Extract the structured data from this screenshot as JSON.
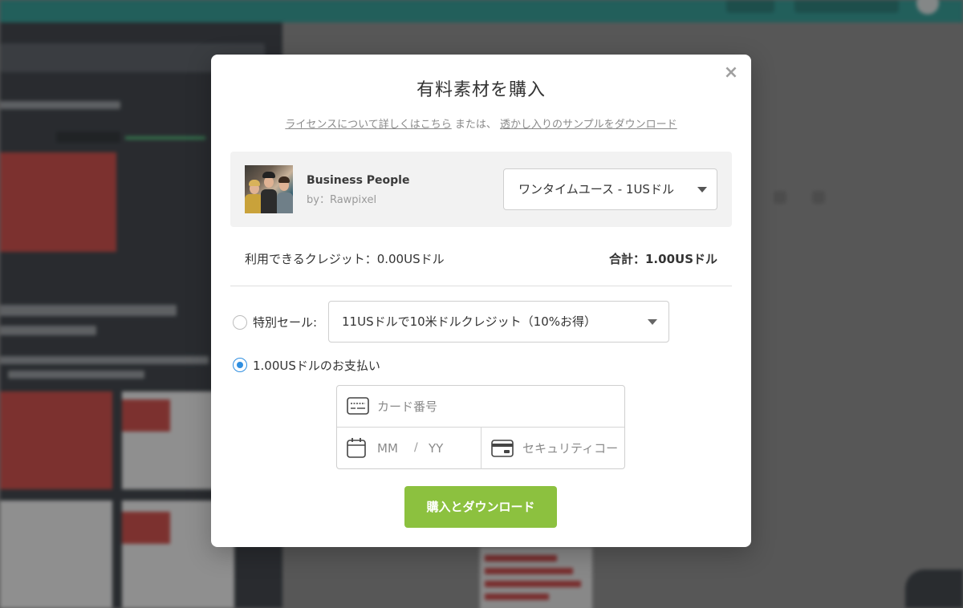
{
  "modal": {
    "title": "有料素材を購入",
    "close_symbol": "×",
    "license_link": "ライセンスについて詳しくはこちら",
    "separator_text": "または、",
    "sample_link": "透かし入りのサンプルをダウンロード",
    "item": {
      "name": "Business People",
      "author": "by：Rawpixel"
    },
    "license_option": "ワンタイムユース - 1USドル",
    "credits": "利用できるクレジット：0.00USドル",
    "total": "合計：1.00USドル",
    "sale": {
      "label": "特別セール:",
      "option": "11USドルで10米ドルクレジット（10%お得）",
      "checked": false
    },
    "pay": {
      "label": "1.00USドルのお支払い",
      "checked": true
    },
    "card_form": {
      "card_number_placeholder": "カード番号",
      "month_placeholder": "MM",
      "slash": "/",
      "year_placeholder": "YY",
      "cvc_placeholder": "セキュリティコード"
    },
    "buy_button": "購入とダウンロード"
  },
  "colors": {
    "accent_green": "#8cc13f",
    "radio_blue": "#2f8ee0",
    "topbar_teal": "#1e8c86"
  }
}
